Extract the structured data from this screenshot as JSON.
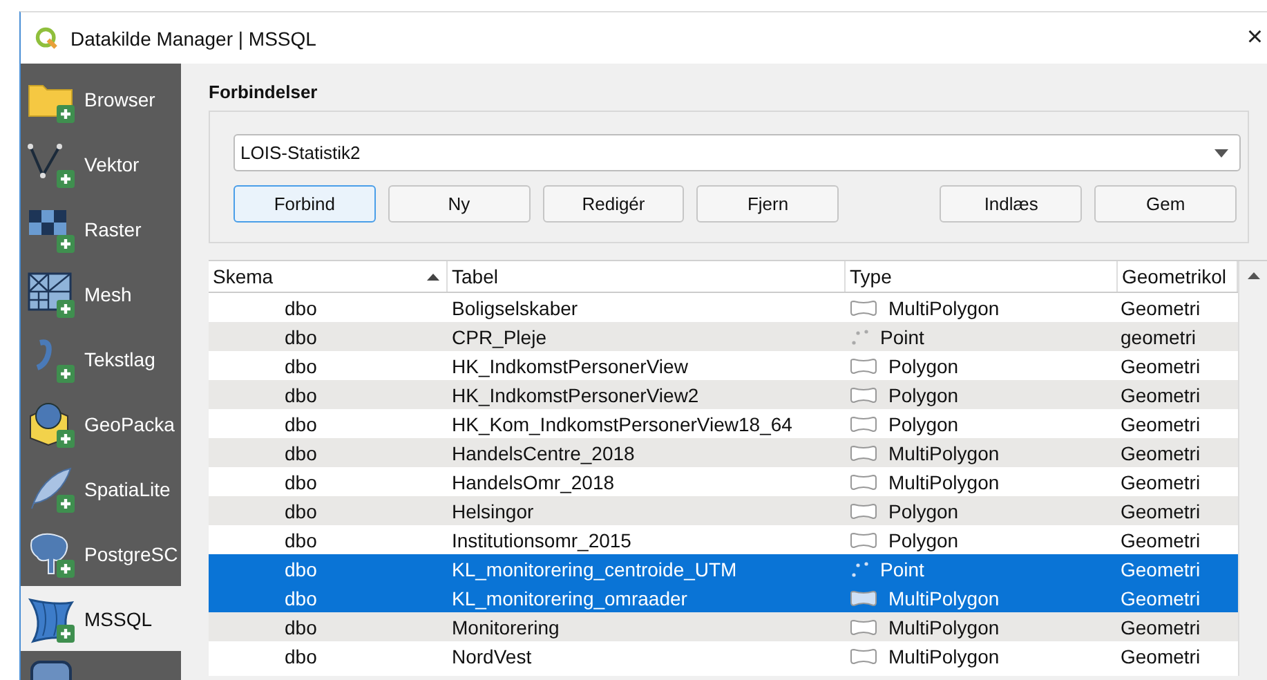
{
  "window": {
    "title": "Datakilde Manager | MSSQL",
    "close": "×"
  },
  "sidebar": {
    "items": [
      {
        "label": "Browser",
        "kind": "folder",
        "selected": false
      },
      {
        "label": "Vektor",
        "kind": "vector",
        "selected": false
      },
      {
        "label": "Raster",
        "kind": "raster",
        "selected": false
      },
      {
        "label": "Mesh",
        "kind": "mesh",
        "selected": false
      },
      {
        "label": "Tekstlag",
        "kind": "text",
        "selected": false
      },
      {
        "label": "GeoPacka",
        "kind": "geopackage",
        "selected": false
      },
      {
        "label": "SpatiaLite",
        "kind": "feather",
        "selected": false
      },
      {
        "label": "PostgreSC",
        "kind": "elephant",
        "selected": false
      },
      {
        "label": "MSSQL",
        "kind": "sail",
        "selected": true
      }
    ]
  },
  "connections": {
    "heading": "Forbindelser",
    "value": "LOIS-Statistik2",
    "buttons": [
      {
        "label": "Forbind",
        "selected": true
      },
      {
        "label": "Ny",
        "selected": false
      },
      {
        "label": "Redigér",
        "selected": false
      },
      {
        "label": "Fjern",
        "selected": false
      }
    ],
    "buttons_right": [
      {
        "label": "Indlæs",
        "selected": false
      },
      {
        "label": "Gem",
        "selected": false
      }
    ]
  },
  "table": {
    "columns": [
      "Skema",
      "Tabel",
      "Type",
      "Geometrikol"
    ],
    "rows": [
      {
        "schema": "dbo",
        "table": "Boligselskaber",
        "type": "MultiPolygon",
        "kind": "polygon",
        "geometry": "Geometri",
        "selected": false
      },
      {
        "schema": "dbo",
        "table": "CPR_Pleje",
        "type": "Point",
        "kind": "point",
        "geometry": "geometri",
        "selected": false
      },
      {
        "schema": "dbo",
        "table": "HK_IndkomstPersonerView",
        "type": "Polygon",
        "kind": "polygon",
        "geometry": "Geometri",
        "selected": false
      },
      {
        "schema": "dbo",
        "table": "HK_IndkomstPersonerView2",
        "type": "Polygon",
        "kind": "polygon",
        "geometry": "Geometri",
        "selected": false
      },
      {
        "schema": "dbo",
        "table": "HK_Kom_IndkomstPersonerView18_64",
        "type": "Polygon",
        "kind": "polygon",
        "geometry": "Geometri",
        "selected": false
      },
      {
        "schema": "dbo",
        "table": "HandelsCentre_2018",
        "type": "MultiPolygon",
        "kind": "polygon",
        "geometry": "Geometri",
        "selected": false
      },
      {
        "schema": "dbo",
        "table": "HandelsOmr_2018",
        "type": "MultiPolygon",
        "kind": "polygon",
        "geometry": "Geometri",
        "selected": false
      },
      {
        "schema": "dbo",
        "table": "Helsingor",
        "type": "Polygon",
        "kind": "polygon",
        "geometry": "Geometri",
        "selected": false
      },
      {
        "schema": "dbo",
        "table": "Institutionsomr_2015",
        "type": "Polygon",
        "kind": "polygon",
        "geometry": "Geometri",
        "selected": false
      },
      {
        "schema": "dbo",
        "table": "KL_monitorering_centroide_UTM",
        "type": "Point",
        "kind": "point",
        "geometry": "Geometri",
        "selected": true
      },
      {
        "schema": "dbo",
        "table": "KL_monitorering_omraader",
        "type": "MultiPolygon",
        "kind": "polygon",
        "geometry": "Geometri",
        "selected": true
      },
      {
        "schema": "dbo",
        "table": "Monitorering",
        "type": "MultiPolygon",
        "kind": "polygon",
        "geometry": "Geometri",
        "selected": false
      },
      {
        "schema": "dbo",
        "table": "NordVest",
        "type": "MultiPolygon",
        "kind": "polygon",
        "geometry": "Geometri",
        "selected": false
      }
    ]
  }
}
